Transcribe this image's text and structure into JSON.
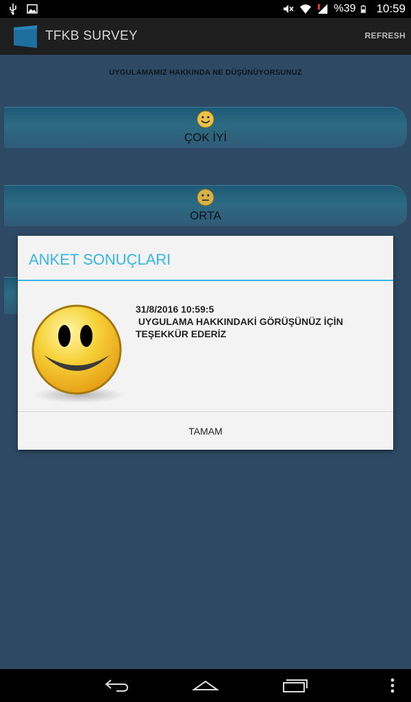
{
  "status_bar": {
    "battery_text": "%39",
    "clock": "10:59"
  },
  "action_bar": {
    "title": "TFKB SURVEY",
    "refresh_label": "REFRESH"
  },
  "survey": {
    "question": "UYGULAMAMIZ HAKKINDA NE DÜŞÜNÜYORSUNUZ",
    "options": [
      {
        "label": "ÇOK İYİ",
        "icon": "happy-face-icon"
      },
      {
        "label": "ORTA",
        "icon": "neutral-face-icon"
      }
    ]
  },
  "dialog": {
    "title": "ANKET SONUÇLARI",
    "timestamp": "31/8/2016 10:59:5",
    "message_line1": " UYGULAMA HAKKINDAKİ GÖRÜŞÜNÜZ İÇİN",
    "message_line2": "TEŞEKKÜR EDERİZ",
    "ok_label": "TAMAM",
    "icon": "smiley-face-icon"
  },
  "colors": {
    "accent": "#33b5e5",
    "background": "#2d4964",
    "option_button": "#2d6a82",
    "action_bar": "#1e1e1e"
  }
}
